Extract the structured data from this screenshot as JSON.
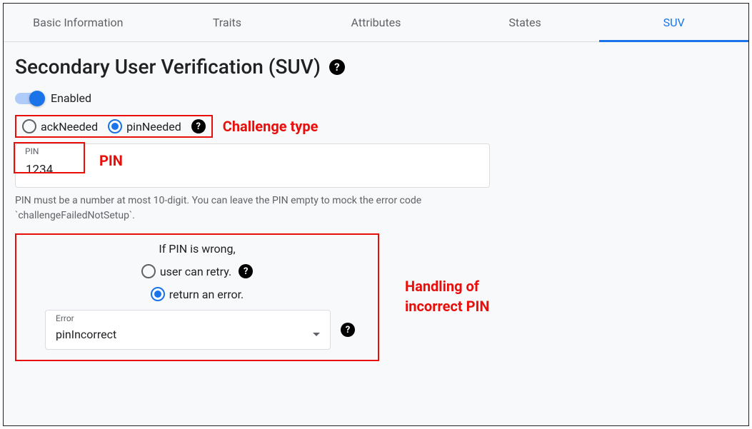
{
  "tabs": {
    "items": [
      {
        "label": "Basic Information"
      },
      {
        "label": "Traits"
      },
      {
        "label": "Attributes"
      },
      {
        "label": "States"
      },
      {
        "label": "SUV"
      }
    ],
    "activeIndex": 4
  },
  "page": {
    "title": "Secondary User Verification (SUV)"
  },
  "toggle": {
    "label": "Enabled",
    "value": true
  },
  "challenge": {
    "options": {
      "ack": "ackNeeded",
      "pin": "pinNeeded"
    },
    "selected": "pinNeeded",
    "annotation": "Challenge type"
  },
  "pinField": {
    "label": "PIN",
    "value": "1234",
    "annotation": "PIN",
    "helper": "PIN must be a number at most 10-digit. You can leave the PIN empty to mock the error code `challengeFailedNotSetup`."
  },
  "wrongPin": {
    "title": "If PIN is wrong,",
    "options": {
      "retry": "user can retry.",
      "error": "return an error."
    },
    "selected": "error",
    "errorSelect": {
      "label": "Error",
      "value": "pinIncorrect"
    },
    "annotation": "Handling of\nincorrect PIN"
  }
}
